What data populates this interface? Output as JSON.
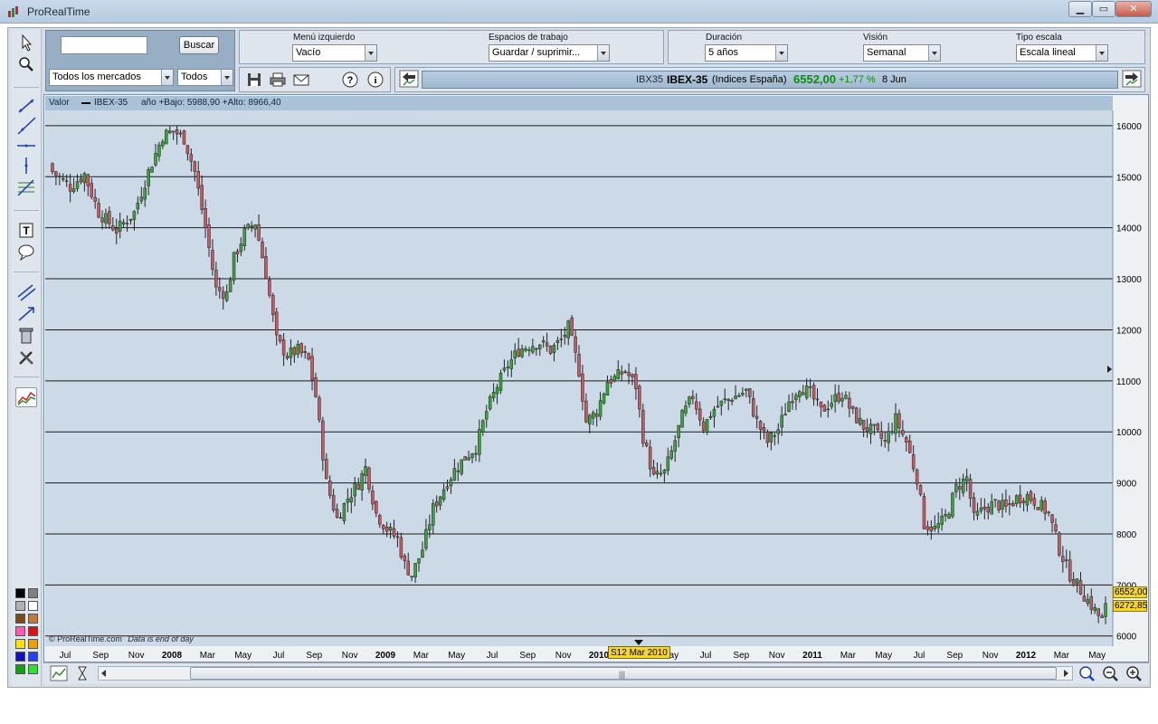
{
  "window": {
    "title": "ProRealTime"
  },
  "search": {
    "placeholder": "",
    "button_label": "Buscar",
    "market_select": "Todos los mercados",
    "type_select": "Todos"
  },
  "options": {
    "left_menu": {
      "label": "Menú izquierdo",
      "value": "Vacío"
    },
    "workspaces": {
      "label": "Espacios de trabajo",
      "value": "Guardar / suprimir..."
    },
    "duration": {
      "label": "Duración",
      "value": "5 años"
    },
    "view": {
      "label": "Visión",
      "value": "Semanal"
    },
    "scale": {
      "label": "Tipo escala",
      "value": "Escala lineal"
    }
  },
  "quote": {
    "code": "IBX35",
    "name": "IBEX-35",
    "market": "(Indices España)",
    "price": "6552,00",
    "change": "+1,77 %",
    "date": "8 Jun"
  },
  "chart_header": {
    "label": "Valor",
    "series": "IBEX-35",
    "range_text": "año +Bajo: 5988,90 +Alto: 8966,40"
  },
  "watermark": {
    "brand": "© ProRealTime.com",
    "note": "Data is end of day"
  },
  "cursor_date": "S12 Mar 2010",
  "colors": {
    "up": "#3aa43a",
    "down": "#c25c62",
    "panel": "#97aec4",
    "chart_bg": "#ccdae7",
    "price_tag": "#f5d530"
  },
  "icons": [
    "arrow-pointer-icon",
    "zoom-icon",
    "line-tool-icon",
    "ray-tool-icon",
    "horizontal-line-icon",
    "vertical-line-icon",
    "fibonacci-icon",
    "text-tool-icon",
    "comment-icon",
    "channel-icon",
    "trend-icon",
    "trash-icon",
    "tools-icon",
    "indicator-icon",
    "save-icon",
    "print-icon",
    "mail-icon",
    "help-icon",
    "info-icon"
  ],
  "chart_data": {
    "type": "candlestick",
    "title": "",
    "xlabel": "",
    "ylabel": "",
    "ylim": [
      5800,
      16300
    ],
    "y_ticks": [
      6000,
      7000,
      8000,
      9000,
      10000,
      11000,
      12000,
      13000,
      14000,
      15000,
      16000
    ],
    "x_ticks": [
      {
        "label": "Jul",
        "bold": false
      },
      {
        "label": "Sep",
        "bold": false
      },
      {
        "label": "Nov",
        "bold": false
      },
      {
        "label": "2008",
        "bold": true
      },
      {
        "label": "Mar",
        "bold": false
      },
      {
        "label": "May",
        "bold": false
      },
      {
        "label": "Jul",
        "bold": false
      },
      {
        "label": "Sep",
        "bold": false
      },
      {
        "label": "Nov",
        "bold": false
      },
      {
        "label": "2009",
        "bold": true
      },
      {
        "label": "Mar",
        "bold": false
      },
      {
        "label": "May",
        "bold": false
      },
      {
        "label": "Jul",
        "bold": false
      },
      {
        "label": "Sep",
        "bold": false
      },
      {
        "label": "Nov",
        "bold": false
      },
      {
        "label": "2010",
        "bold": true
      },
      {
        "label": "Mar",
        "bold": false
      },
      {
        "label": "May",
        "bold": false
      },
      {
        "label": "Jul",
        "bold": false
      },
      {
        "label": "Sep",
        "bold": false
      },
      {
        "label": "Nov",
        "bold": false
      },
      {
        "label": "2011",
        "bold": true
      },
      {
        "label": "Mar",
        "bold": false
      },
      {
        "label": "May",
        "bold": false
      },
      {
        "label": "Jul",
        "bold": false
      },
      {
        "label": "Sep",
        "bold": false
      },
      {
        "label": "Nov",
        "bold": false
      },
      {
        "label": "2012",
        "bold": true
      },
      {
        "label": "Mar",
        "bold": false
      },
      {
        "label": "May",
        "bold": false
      }
    ],
    "price_labels": [
      "6552,00",
      "6272,85"
    ],
    "grid": true,
    "keypoints": [
      [
        0,
        15100
      ],
      [
        5,
        14800
      ],
      [
        9,
        15050
      ],
      [
        13,
        14300
      ],
      [
        18,
        13950
      ],
      [
        23,
        14300
      ],
      [
        27,
        15100
      ],
      [
        31,
        15800
      ],
      [
        34,
        15900
      ],
      [
        37,
        15750
      ],
      [
        40,
        15100
      ],
      [
        43,
        14000
      ],
      [
        46,
        12800
      ],
      [
        49,
        12700
      ],
      [
        51,
        13400
      ],
      [
        54,
        13900
      ],
      [
        57,
        14100
      ],
      [
        60,
        13100
      ],
      [
        63,
        11800
      ],
      [
        66,
        11500
      ],
      [
        69,
        11600
      ],
      [
        72,
        11400
      ],
      [
        74,
        10700
      ],
      [
        77,
        9000
      ],
      [
        80,
        8300
      ],
      [
        83,
        8700
      ],
      [
        86,
        9000
      ],
      [
        88,
        9300
      ],
      [
        91,
        8400
      ],
      [
        94,
        8100
      ],
      [
        97,
        7900
      ],
      [
        99,
        7400
      ],
      [
        101,
        7200
      ],
      [
        104,
        7700
      ],
      [
        107,
        8500
      ],
      [
        110,
        8900
      ],
      [
        113,
        9250
      ],
      [
        116,
        9500
      ],
      [
        119,
        9700
      ],
      [
        122,
        10400
      ],
      [
        125,
        10900
      ],
      [
        128,
        11300
      ],
      [
        131,
        11600
      ],
      [
        134,
        11700
      ],
      [
        137,
        11750
      ],
      [
        140,
        11600
      ],
      [
        143,
        11800
      ],
      [
        145,
        12050
      ],
      [
        148,
        11200
      ],
      [
        150,
        10200
      ],
      [
        153,
        10400
      ],
      [
        156,
        11000
      ],
      [
        158,
        11050
      ],
      [
        161,
        11200
      ],
      [
        164,
        10900
      ],
      [
        166,
        9900
      ],
      [
        169,
        9100
      ],
      [
        172,
        9200
      ],
      [
        174,
        9600
      ],
      [
        177,
        10300
      ],
      [
        180,
        10700
      ],
      [
        183,
        10100
      ],
      [
        186,
        10450
      ],
      [
        189,
        10600
      ],
      [
        192,
        10700
      ],
      [
        195,
        10800
      ],
      [
        198,
        10200
      ],
      [
        201,
        9800
      ],
      [
        204,
        10050
      ],
      [
        207,
        10600
      ],
      [
        210,
        10900
      ],
      [
        213,
        10750
      ],
      [
        216,
        10400
      ],
      [
        219,
        10600
      ],
      [
        222,
        10750
      ],
      [
        225,
        10350
      ],
      [
        228,
        10100
      ],
      [
        231,
        10000
      ],
      [
        234,
        9800
      ],
      [
        237,
        10250
      ],
      [
        240,
        9800
      ],
      [
        243,
        9100
      ],
      [
        245,
        8200
      ],
      [
        248,
        8100
      ],
      [
        251,
        8300
      ],
      [
        254,
        8900
      ],
      [
        257,
        9100
      ],
      [
        259,
        8300
      ],
      [
        262,
        8500
      ],
      [
        265,
        8600
      ],
      [
        268,
        8500
      ],
      [
        271,
        8700
      ],
      [
        274,
        8750
      ],
      [
        277,
        8600
      ],
      [
        280,
        8400
      ],
      [
        283,
        7700
      ],
      [
        286,
        7200
      ],
      [
        289,
        6900
      ],
      [
        292,
        6600
      ],
      [
        295,
        6300
      ],
      [
        296,
        6552
      ]
    ]
  }
}
